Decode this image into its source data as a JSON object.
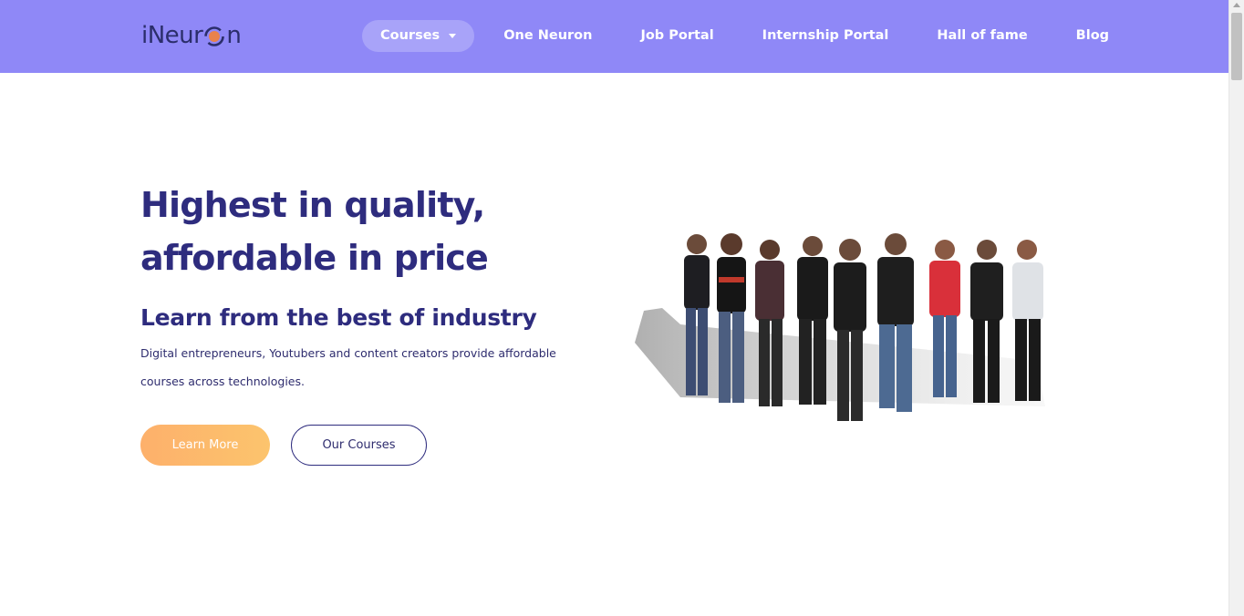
{
  "brand": {
    "logo_text_before": "iNeur",
    "logo_text_after": "n",
    "colors": {
      "nav_bg": "#8f88f7",
      "primary_text": "#2e2c7e",
      "accent_orange": "#fdb06b"
    }
  },
  "nav": {
    "items": [
      {
        "label": "Courses",
        "has_dropdown": true,
        "active": true
      },
      {
        "label": "One Neuron"
      },
      {
        "label": "Job Portal"
      },
      {
        "label": "Internship Portal"
      },
      {
        "label": "Hall of fame"
      },
      {
        "label": "Blog"
      }
    ]
  },
  "hero": {
    "title_line1": "Highest in quality,",
    "title_line2": "affordable in price",
    "subtitle": "Learn from the best of industry",
    "description": "Digital entrepreneurs, Youtubers and content creators provide affordable courses across technologies.",
    "learn_more_label": "Learn More",
    "our_courses_label": "Our Courses"
  }
}
